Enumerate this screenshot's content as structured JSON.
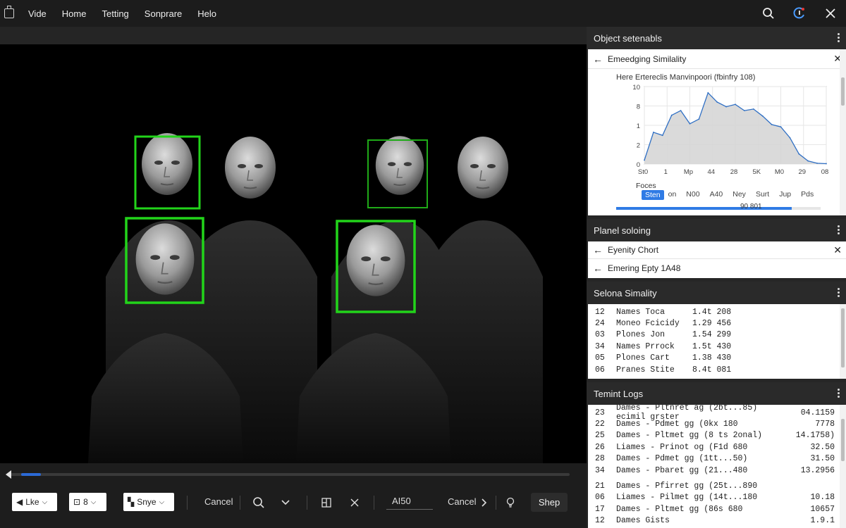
{
  "menubar": {
    "items": [
      "Vide",
      "Home",
      "Tetting",
      "Sonprare",
      "Helo"
    ]
  },
  "colors": {
    "accent": "#2c6ad6",
    "detection_box": "#22d41a",
    "panel_bg": "#262626"
  },
  "icons": {
    "app": "app-icon",
    "search": "search-icon",
    "account": "account-icon",
    "close": "close-icon"
  },
  "panels": {
    "object_panel": {
      "title": "Object setenabls",
      "sub_title": "Emeedging Similality",
      "chart_title": "Here Ertereclis Manvinpoori (fbinfry 108)",
      "tabs": [
        "Sten",
        "on",
        "N00",
        "A40",
        "Ney",
        "Surt",
        "Jup",
        "Pds"
      ],
      "selected_tab": "Sten",
      "progress_label": "90 801",
      "progress_fraction": 0.86
    },
    "planel_panel": {
      "title": "Planel soloing",
      "rows": [
        "Eyenity Chort",
        "Emering Epty 1A48"
      ]
    },
    "similarity_panel": {
      "title": "Selona Simality",
      "rows": [
        {
          "id": "12",
          "name": "Names  Toca",
          "value": "1.4t 208"
        },
        {
          "id": "24",
          "name": "Moneo  Fcicidy",
          "value": "1.29 456"
        },
        {
          "id": "03",
          "name": "Plones  Jon",
          "value": "1.54 299"
        },
        {
          "id": "34",
          "name": "Names  Prrock",
          "value": "1.5t 430"
        },
        {
          "id": "05",
          "name": "Plones  Cart",
          "value": "1.38 430"
        },
        {
          "id": "06",
          "name": "Pranes  Stite",
          "value": "8.4t 081"
        }
      ]
    },
    "terminal_panel": {
      "title": "Temint Logs",
      "group1": [
        {
          "id": "23",
          "text": "Dames - Pltnret ag (2bt...85) ecimil grster",
          "value": "04.1159"
        },
        {
          "id": "22",
          "text": "Dames - Pdmet gg (0kx 180",
          "value": "7778"
        },
        {
          "id": "25",
          "text": "Dames - Pltmet gg (8 ts 2onal)",
          "value": "14.1758)"
        },
        {
          "id": "26",
          "text": "Liames - Prinot og (F1d 680",
          "value": "32.50"
        },
        {
          "id": "28",
          "text": "Dames - Pdmet gg (1tt...50)",
          "value": "31.50"
        },
        {
          "id": "34",
          "text": "Dames - Pbaret gg (21...480",
          "value": "13.2956"
        }
      ],
      "group2": [
        {
          "id": "21",
          "text": "Dames - Pfirret gg (25t...890",
          "value": ""
        },
        {
          "id": "06",
          "text": "Liames - Pilmet gg (14t...180",
          "value": "10.18"
        },
        {
          "id": "17",
          "text": "Dames - Pltmet gg (86s 680",
          "value": "10657"
        },
        {
          "id": "12",
          "text": "Dames Gists",
          "value": "1.9.1"
        }
      ]
    }
  },
  "controls": {
    "dropdowns": [
      "Lke",
      "8",
      "Snye"
    ],
    "cancel1": "Cancel",
    "abo": "AI50",
    "cancel2": "Cancel",
    "shop": "Shep"
  },
  "chart_data": {
    "type": "area",
    "title": "Here Ertereclis Manvinpoori (fbinfry 108)",
    "xlabel": "Foces",
    "ylabel": "",
    "x_tick_labels": [
      "St0",
      "1",
      "Mp",
      "44",
      "28",
      "5K",
      "M0",
      "29",
      "08"
    ],
    "y_tick_labels": [
      "10",
      "8",
      "1",
      "2",
      "0"
    ],
    "ylim": [
      0,
      10
    ],
    "grid": true,
    "series": [
      {
        "values": [
          0.5,
          4.1,
          3.7,
          6.3,
          6.9,
          5.2,
          5.8,
          9.2,
          8.0,
          7.4,
          7.7,
          6.9,
          7.1,
          6.2,
          5.1,
          4.8,
          3.4,
          1.3,
          0.4,
          0.1,
          0.05
        ]
      }
    ]
  }
}
